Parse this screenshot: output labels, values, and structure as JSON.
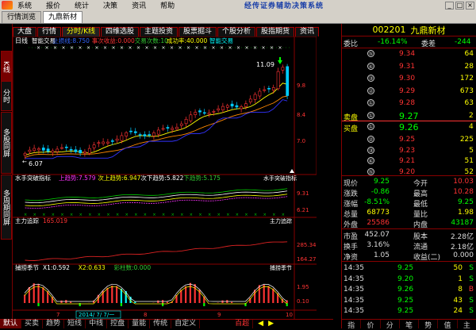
{
  "menu": {
    "items": [
      "系统",
      "报价",
      "统计",
      "决策",
      "资讯",
      "帮助"
    ],
    "app_title": "经传证券辅助决策系统",
    "window_controls": [
      "_",
      "□",
      "×"
    ]
  },
  "page_tabs": [
    "行情浏览",
    "九鼎新材"
  ],
  "left_tabs": [
    "K线",
    "分时",
    "多股同屏",
    "多周期同屏"
  ],
  "top_tabs": [
    "大盘",
    "行情",
    "分时/K线",
    "四维选股",
    "主题投资",
    "股票掘斗",
    "个股分析",
    "股指期货",
    "资讯"
  ],
  "main_chart": {
    "period": "日线",
    "indicator_labels": [
      {
        "text": "智能交易",
        "color": "#ffffff"
      },
      {
        "text": "止损线:8.750",
        "color": "#3366ff"
      },
      {
        "text": "事次收益:0.000",
        "color": "#ff3333"
      },
      {
        "text": "交易次数:10",
        "color": "#33cc33"
      },
      {
        "text": "成功率:40.000",
        "color": "#ffff00"
      },
      {
        "text": "智能交易",
        "color": "#00ffff"
      }
    ],
    "peak_label": "11.09",
    "low_label": "6.07",
    "price_ticks": [
      "9.8",
      "8.4",
      "7.0"
    ]
  },
  "chart_data": {
    "type": "candlestick",
    "high_label": 11.09,
    "low_label": 6.07,
    "y_ticks": [
      9.8,
      8.4,
      7.0
    ],
    "x_ticks": [
      "7",
      "2014/ 7/ 7/一",
      "8",
      "9",
      "10"
    ]
  },
  "panel_shou": {
    "title": "水手突破指标",
    "labels": [
      {
        "text": "上趋势:7.579",
        "color": "#ff33ff"
      },
      {
        "text": "次上趋势:6.947",
        "color": "#ffff00"
      },
      {
        "text": "次下趋势:5.822",
        "color": "#ffffff"
      },
      {
        "text": "下趋势:5.175",
        "color": "#33cc33"
      }
    ],
    "right_title": "水手突破指标",
    "ticks": [
      "9.31",
      "6.21"
    ]
  },
  "panel_zhuli": {
    "title": "主力追踪",
    "value": "165.019",
    "right_title": "主力追踪",
    "ticks": [
      "285.34",
      "164.27"
    ]
  },
  "panel_buhuo": {
    "title": "捕捞季节",
    "labels": [
      {
        "text": "X1:0.592",
        "color": "#ffffff"
      },
      {
        "text": "X2:0.633",
        "color": "#ffff00"
      },
      {
        "text": "彩柱数:0.000",
        "color": "#33cc33"
      }
    ],
    "right_title": "捕捞季节",
    "ticks": [
      "1.95",
      "0.10"
    ]
  },
  "bottom_tabs": [
    "默认",
    "买卖",
    "趋势",
    "短线",
    "中线",
    "控盘",
    "量能",
    "传统",
    "自定义"
  ],
  "bottom_extra": "百超",
  "right_panel": {
    "code": "002201",
    "name": "九鼎新材",
    "weibi_label": "委比",
    "weibi_value": "-16.14%",
    "weicha_label": "委差",
    "weicha_value": "-244",
    "sell_rows": [
      {
        "n": "⑤",
        "price": "9.34",
        "vol": "64"
      },
      {
        "n": "④",
        "price": "9.31",
        "vol": "28"
      },
      {
        "n": "③",
        "price": "9.30",
        "vol": "172"
      },
      {
        "n": "②",
        "price": "9.29",
        "vol": "673"
      },
      {
        "n": "①",
        "price": "9.28",
        "vol": "63"
      }
    ],
    "ask_label": "卖盘",
    "ask_n": "①",
    "ask_price": "9.27",
    "ask_vol": "2",
    "bid_label": "买盘",
    "bid_n": "①",
    "bid_price": "9.26",
    "bid_vol": "4",
    "buy_rows": [
      {
        "n": "②",
        "price": "9.25",
        "vol": "225"
      },
      {
        "n": "③",
        "price": "9.23",
        "vol": "5"
      },
      {
        "n": "④",
        "price": "9.21",
        "vol": "51"
      },
      {
        "n": "⑤",
        "price": "9.20",
        "vol": "52"
      }
    ],
    "stats": [
      {
        "l1": "现价",
        "v1": "9.25",
        "c1": "green",
        "l2": "今开",
        "v2": "10.03",
        "c2": "red"
      },
      {
        "l1": "涨跌",
        "v1": "-0.86",
        "c1": "green",
        "l2": "最高",
        "v2": "10.28",
        "c2": "red"
      },
      {
        "l1": "涨幅",
        "v1": "-8.51%",
        "c1": "green",
        "l2": "最低",
        "v2": "9.25",
        "c2": "green"
      },
      {
        "l1": "总量",
        "v1": "68773",
        "c1": "yellow",
        "l2": "量比",
        "v2": "1.98",
        "c2": "yellow"
      },
      {
        "l1": "外盘",
        "v1": "25586",
        "c1": "red",
        "l2": "内盘",
        "v2": "43187",
        "c2": "green"
      }
    ],
    "stats2": [
      {
        "l1": "市盈",
        "v1": "452.07",
        "l2": "股本",
        "v2": "2.28亿"
      },
      {
        "l1": "换手",
        "v1": "3.16%",
        "l2": "流通",
        "v2": "2.18亿"
      },
      {
        "l1": "净资",
        "v1": "1.05",
        "l2": "收益(二)",
        "v2": "0.000"
      }
    ],
    "ticks": [
      {
        "time": "14:35",
        "price": "9.25",
        "vol": "50",
        "flag": "S"
      },
      {
        "time": "14:35",
        "price": "9.20",
        "vol": "1",
        "flag": "S"
      },
      {
        "time": "14:35",
        "price": "9.26",
        "vol": "8",
        "flag": "B"
      },
      {
        "time": "14:35",
        "price": "9.25",
        "vol": "43",
        "flag": "S"
      },
      {
        "time": "14:35",
        "price": "9.25",
        "vol": "24",
        "flag": "S"
      }
    ],
    "bottom_tabs": [
      "指",
      "价",
      "分",
      "笔",
      "势",
      "值",
      "主"
    ]
  }
}
